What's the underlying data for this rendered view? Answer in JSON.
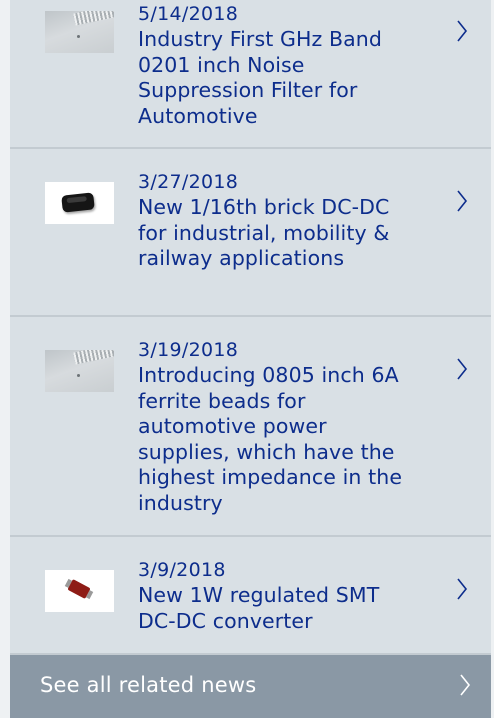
{
  "news": {
    "items": [
      {
        "date": "5/14/2018",
        "title": "Industry First GHz Band 0201 inch Noise Suppression Filter for Automotive",
        "thumbnail": "noise-suppression-filter-image"
      },
      {
        "date": "3/27/2018",
        "title": "New 1/16th brick DC-DC for industrial, mobility & railway applications",
        "thumbnail": "dc-dc-brick-module-image"
      },
      {
        "date": "3/19/2018",
        "title": "Introducing 0805 inch 6A ferrite beads for automotive power supplies, which have the highest impedance in the industry",
        "thumbnail": "ferrite-bead-image"
      },
      {
        "date": "3/9/2018",
        "title": "New 1W regulated SMT DC-DC converter",
        "thumbnail": "smt-dc-dc-converter-image"
      }
    ],
    "see_all_label": "See all related news"
  },
  "colors": {
    "background": "#d9e0e5",
    "text": "#0d2d8c",
    "divider": "#c3cbd1",
    "see_all_bg": "#8a98a5",
    "see_all_text": "#ffffff"
  },
  "icons": {
    "item_arrow": "chevron-right-icon",
    "see_all_arrow": "chevron-right-icon"
  }
}
